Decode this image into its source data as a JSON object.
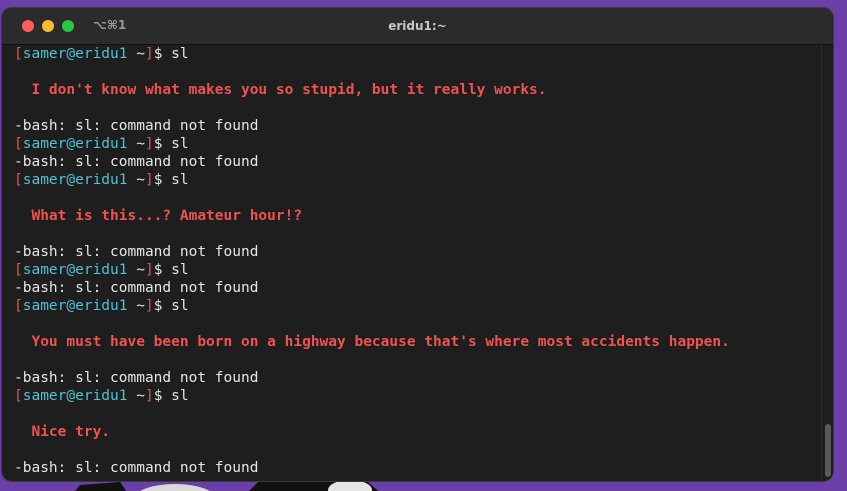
{
  "window": {
    "title": "eridu1:~",
    "shortcut": "⌥⌘1"
  },
  "prompt": {
    "open_bracket": "[",
    "user_host": "samer@eridu1",
    "close_bracket_space": " ~]",
    "symbol": "$ ",
    "user": "samer",
    "host": "eridu1",
    "cwd": "~"
  },
  "lines": [
    {
      "type": "prompt",
      "command": "sl"
    },
    {
      "type": "blank"
    },
    {
      "type": "insult",
      "text": "  I don't know what makes you so stupid, but it really works."
    },
    {
      "type": "blank"
    },
    {
      "type": "output",
      "text": "-bash: sl: command not found"
    },
    {
      "type": "prompt",
      "command": "sl"
    },
    {
      "type": "output",
      "text": "-bash: sl: command not found"
    },
    {
      "type": "prompt",
      "command": "sl"
    },
    {
      "type": "blank"
    },
    {
      "type": "insult",
      "text": "  What is this...? Amateur hour!?"
    },
    {
      "type": "blank"
    },
    {
      "type": "output",
      "text": "-bash: sl: command not found"
    },
    {
      "type": "prompt",
      "command": "sl"
    },
    {
      "type": "output",
      "text": "-bash: sl: command not found"
    },
    {
      "type": "prompt",
      "command": "sl"
    },
    {
      "type": "blank"
    },
    {
      "type": "insult",
      "text": "  You must have been born on a highway because that's where most accidents happen."
    },
    {
      "type": "blank"
    },
    {
      "type": "output",
      "text": "-bash: sl: command not found"
    },
    {
      "type": "prompt",
      "command": "sl"
    },
    {
      "type": "blank"
    },
    {
      "type": "insult",
      "text": "  Nice try."
    },
    {
      "type": "blank"
    },
    {
      "type": "output",
      "text": "-bash: sl: command not found"
    }
  ],
  "scrollbar": {
    "position_fraction": 0.79,
    "visible_fraction": 0.29
  },
  "colors": {
    "user_host": "#4ec1d6",
    "bracket": "#e0564f",
    "insult": "#ef5350",
    "text": "#e6e6e6",
    "background": "#1e1e1e"
  }
}
